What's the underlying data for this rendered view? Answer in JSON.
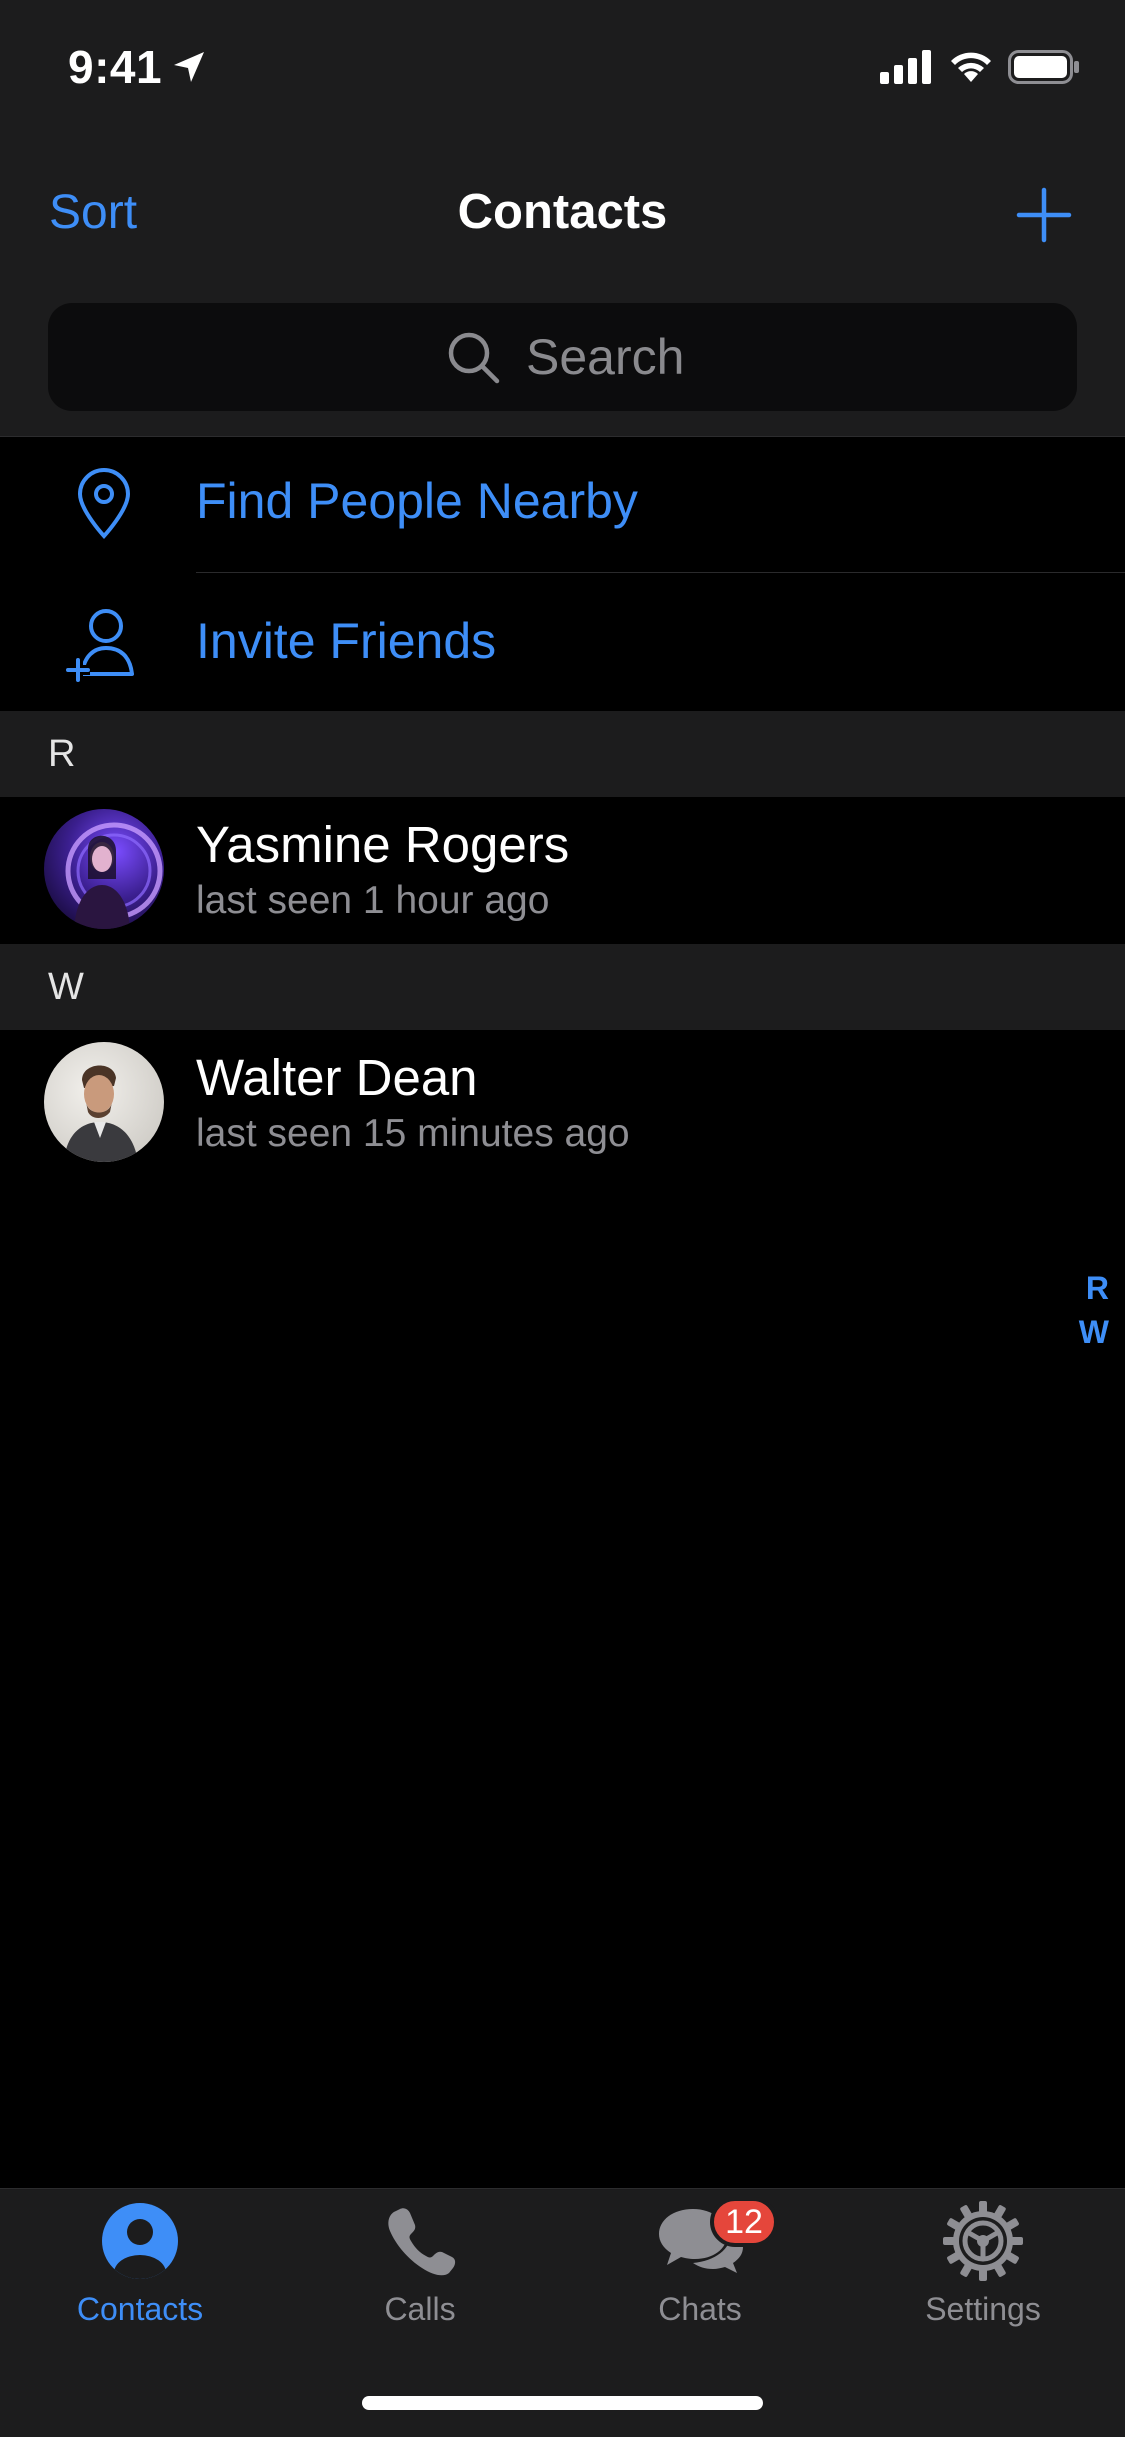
{
  "status_bar": {
    "time": "9:41"
  },
  "nav": {
    "sort_label": "Sort",
    "title": "Contacts"
  },
  "search": {
    "placeholder": "Search"
  },
  "actions": [
    {
      "label": "Find People Nearby",
      "icon": "location-pin-icon"
    },
    {
      "label": "Invite Friends",
      "icon": "add-person-icon"
    }
  ],
  "sections": [
    {
      "letter": "R",
      "contacts": [
        {
          "name": "Yasmine Rogers",
          "status": "last seen 1 hour ago"
        }
      ]
    },
    {
      "letter": "W",
      "contacts": [
        {
          "name": "Walter Dean",
          "status": "last seen 15 minutes ago"
        }
      ]
    }
  ],
  "index": [
    "R",
    "W"
  ],
  "tabs": [
    {
      "label": "Contacts",
      "icon": "person-circle-icon",
      "active": true
    },
    {
      "label": "Calls",
      "icon": "phone-icon",
      "active": false
    },
    {
      "label": "Chats",
      "icon": "chat-bubbles-icon",
      "active": false,
      "badge": "12"
    },
    {
      "label": "Settings",
      "icon": "gear-icon",
      "active": false
    }
  ],
  "colors": {
    "accent": "#3e8ef7",
    "background": "#000000",
    "bar_background": "#1c1c1d",
    "badge": "#e5463b",
    "secondary_text": "#8e8e93"
  }
}
